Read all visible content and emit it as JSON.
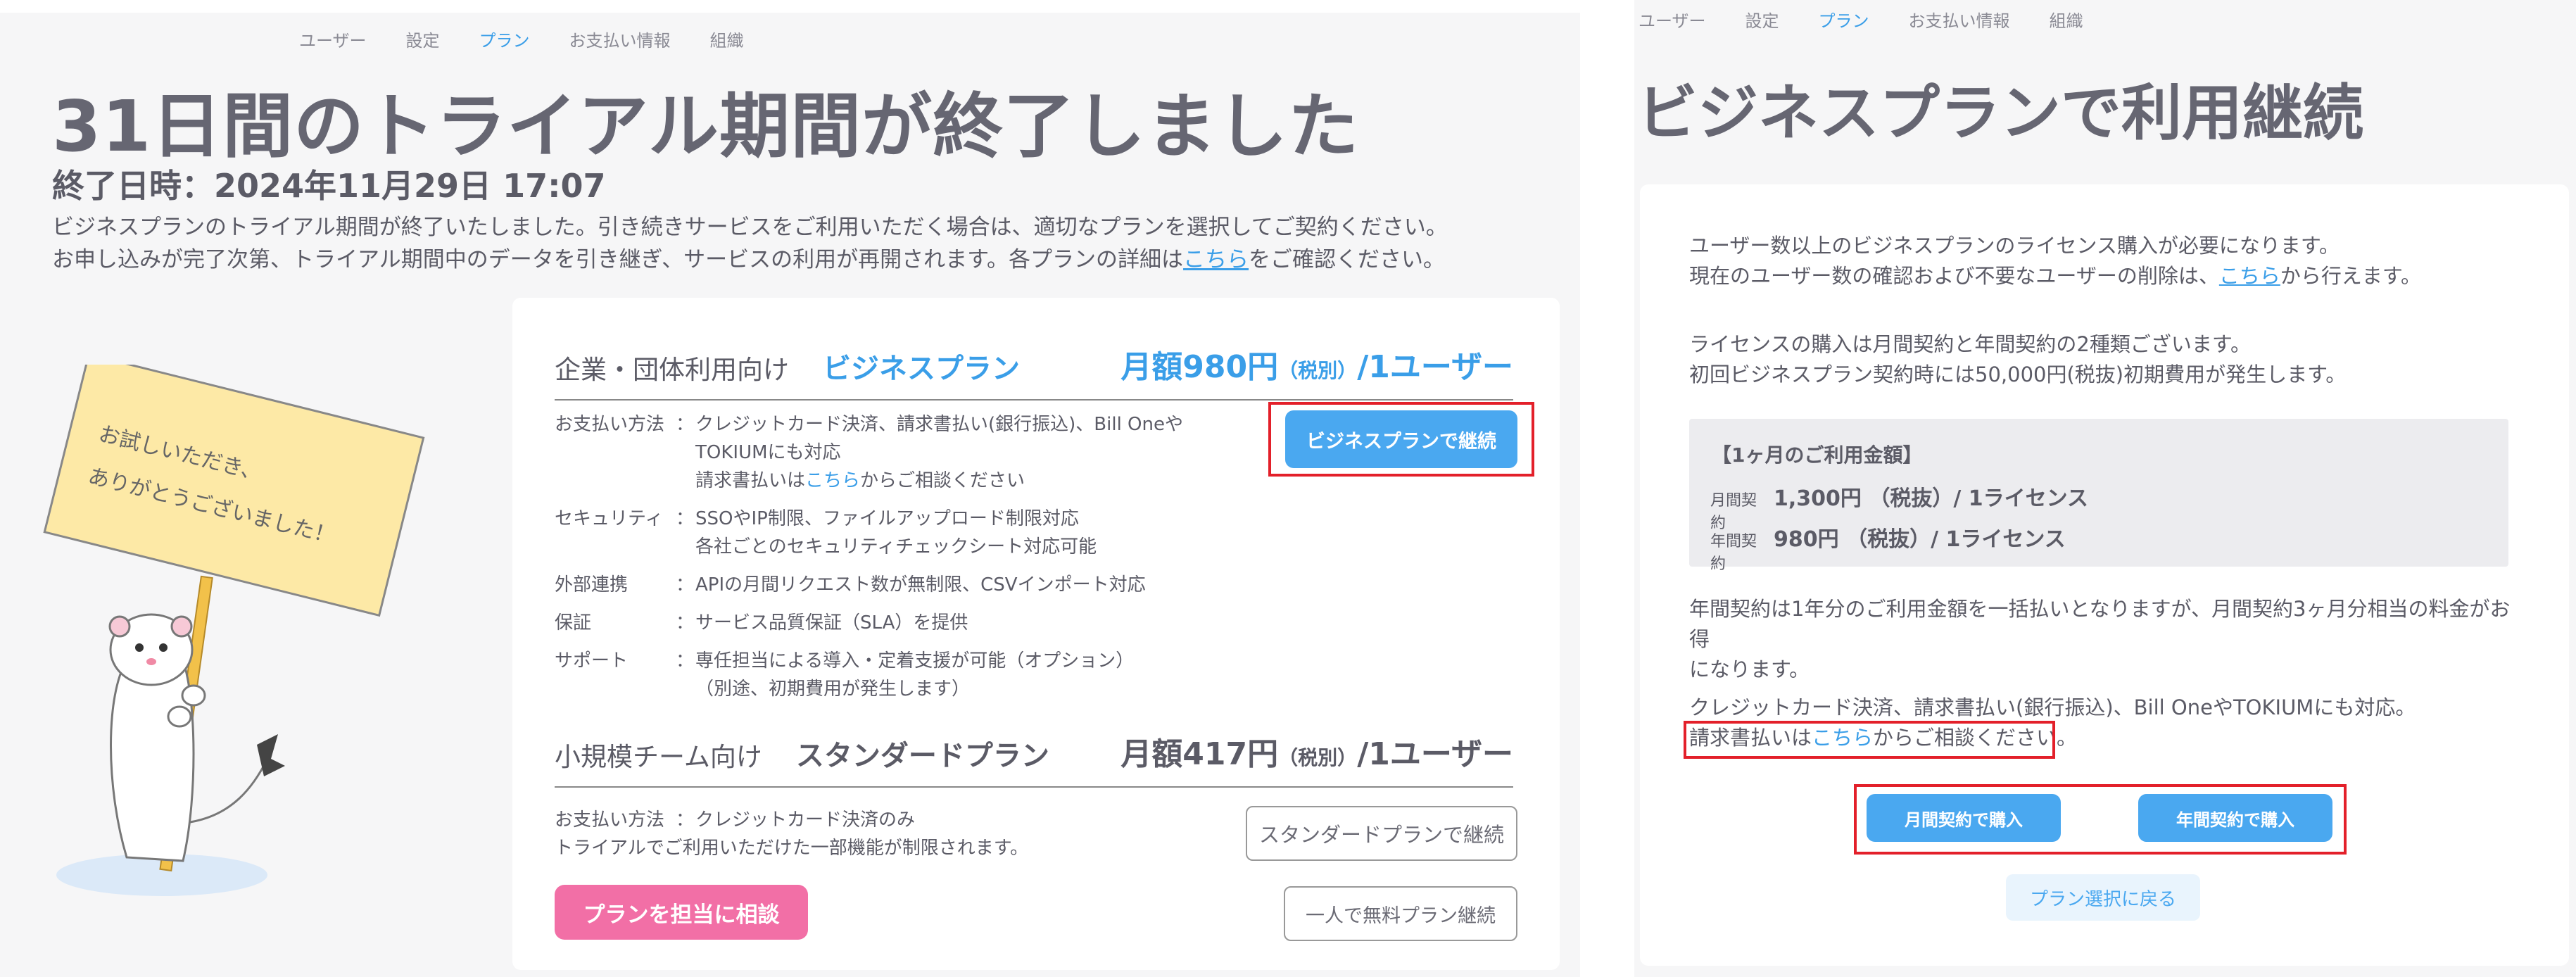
{
  "nav": {
    "items": [
      "ユーザー",
      "設定",
      "プラン",
      "お支払い情報",
      "組織"
    ],
    "active_index": 2
  },
  "left": {
    "title": "31日間のトライアル期間が終了しました",
    "end_datetime": "終了日時：2024年11月29日 17:07",
    "desc_line1": "ビジネスプランのトライアル期間が終了いたしました。引き続きサービスをご利用いただく場合は、適切なプランを選択してご契約ください。",
    "desc_line2_pre": "お申し込みが完了次第、トライアル期間中のデータを引き継ぎ、サービスの利用が再開されます。各プランの詳細は",
    "desc_link": "こちら",
    "desc_line2_post": "をご確認ください。",
    "sign_text_line1": "お試しいただき、",
    "sign_text_line2": "ありがとうございました！",
    "business": {
      "target": "企業・団体利用向け",
      "name": "ビジネスプラン",
      "price_main": "月額980円",
      "price_tax": "（税別）",
      "price_unit": "/1ユーザー",
      "button": "ビジネスプランで継続",
      "features": [
        {
          "key": "お支払い方法",
          "colon": "：",
          "lines": [
            "クレジットカード決済、請求書払い(銀行振込)、Bill Oneや",
            "TOKIUMにも対応"
          ],
          "extra_pre": "請求書払いは",
          "extra_link": "こちら",
          "extra_post": "からご相談ください"
        },
        {
          "key": "セキュリティ",
          "colon": "：",
          "lines": [
            "SSOやIP制限、ファイルアップロード制限対応",
            "各社ごとのセキュリティチェックシート対応可能"
          ]
        },
        {
          "key": "外部連携",
          "colon": "：",
          "lines": [
            "APIの月間リクエスト数が無制限、CSVインポート対応"
          ]
        },
        {
          "key": "保証",
          "colon": "：",
          "lines": [
            "サービス品質保証（SLA）を提供"
          ]
        },
        {
          "key": "サポート",
          "colon": "：",
          "lines": [
            "専任担当による導入・定着支援が可能（オプション）",
            "（別途、初期費用が発生します）"
          ]
        }
      ]
    },
    "standard": {
      "target": "小規模チーム向け",
      "name": "スタンダードプラン",
      "price_main": "月額417円",
      "price_tax": "（税別）",
      "price_unit": "/1ユーザー",
      "pay_key": "お支払い方法",
      "pay_colon": "：",
      "pay_value": "クレジットカード決済のみ",
      "note": "トライアルでご利用いただけた一部機能が制限されます。",
      "button": "スタンダードプランで継続"
    },
    "consult_button": "プランを担当に相談",
    "free_button": "一人で無料プラン継続"
  },
  "right": {
    "title": "ビジネスプランで利用継続",
    "p1_line1": "ユーザー数以上のビジネスプランのライセンス購入が必要になります。",
    "p1_line2_pre": "現在のユーザー数の確認および不要なユーザーの削除は、",
    "p1_link": "こちら",
    "p1_line2_post": "から行えます。",
    "p2_line1": "ライセンスの購入は月間契約と年間契約の2種類ございます。",
    "p2_line2": "初回ビジネスプラン契約時には50,000円(税抜)初期費用が発生します。",
    "price_box": {
      "title": "【1ヶ月のご利用金額】",
      "monthly_label": "月間契約",
      "monthly_value": "1,300円 （税抜）/ 1ライセンス",
      "yearly_label": "年間契約",
      "yearly_value": "980円 （税抜）/ 1ライセンス"
    },
    "p3_line1": "年間契約は1年分のご利用金額を一括払いとなりますが、月間契約3ヶ月分相当の料金がお得",
    "p3_line2": "になります。",
    "p4_line1": "クレジットカード決済、請求書払い(銀行振込)、Bill OneやTOKIUMにも対応。",
    "p4_line2_pre": "請求書払いは",
    "p4_link": "こちら",
    "p4_line2_post": "からご相談ください。",
    "monthly_button": "月間契約で購入",
    "yearly_button": "年間契約で購入",
    "back_button": "プラン選択に戻る"
  },
  "colors": {
    "accent": "#4aa8f0",
    "pink": "#f26fa6",
    "highlight": "#e3202a",
    "text": "#5b5b66"
  }
}
